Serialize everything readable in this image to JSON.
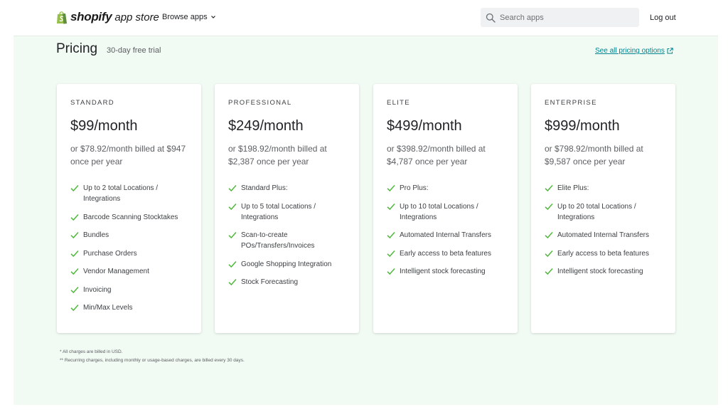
{
  "header": {
    "logo_brand": "shopify",
    "logo_sub": "app store",
    "browse_label": "Browse apps",
    "search_placeholder": "Search apps",
    "logout_label": "Log out"
  },
  "pricing": {
    "title": "Pricing",
    "trial": "30-day free trial",
    "see_all": "See all pricing options",
    "plans": [
      {
        "name": "STANDARD",
        "price": "$99/month",
        "annual": "or $78.92/month billed at $947 once per year",
        "features": [
          "Up to 2 total Locations / Integrations",
          "Barcode Scanning Stocktakes",
          "Bundles",
          "Purchase Orders",
          "Vendor Management",
          "Invoicing",
          "Min/Max Levels"
        ]
      },
      {
        "name": "PROFESSIONAL",
        "price": "$249/month",
        "annual": "or $198.92/month billed at $2,387 once per year",
        "features": [
          "Standard Plus:",
          "Up to 5 total Locations / Integrations",
          "Scan-to-create POs/Transfers/Invoices",
          "Google Shopping Integration",
          "Stock Forecasting"
        ]
      },
      {
        "name": "ELITE",
        "price": "$499/month",
        "annual": "or $398.92/month billed at $4,787 once per year",
        "features": [
          "Pro Plus:",
          "Up to 10 total Locations / Integrations",
          "Automated Internal Transfers",
          "Early access to beta features",
          "Intelligent stock forecasting"
        ]
      },
      {
        "name": "ENTERPRISE",
        "price": "$999/month",
        "annual": "or $798.92/month billed at $9,587 once per year",
        "features": [
          "Elite Plus:",
          "Up to 20 total Locations / Integrations",
          "Automated Internal Transfers",
          "Early access to beta features",
          "Intelligent stock forecasting"
        ]
      }
    ],
    "notes": [
      "* All charges are billed in USD.",
      "** Recurring charges, including monthly or usage-based charges, are billed every 30 days."
    ]
  },
  "colors": {
    "accent_green": "#50b83c",
    "panel_bg": "#f1faf3",
    "link": "#00848e"
  },
  "icons": [
    "shopify-bag-icon",
    "chevron-down-icon",
    "search-icon",
    "external-link-icon",
    "check-icon"
  ]
}
